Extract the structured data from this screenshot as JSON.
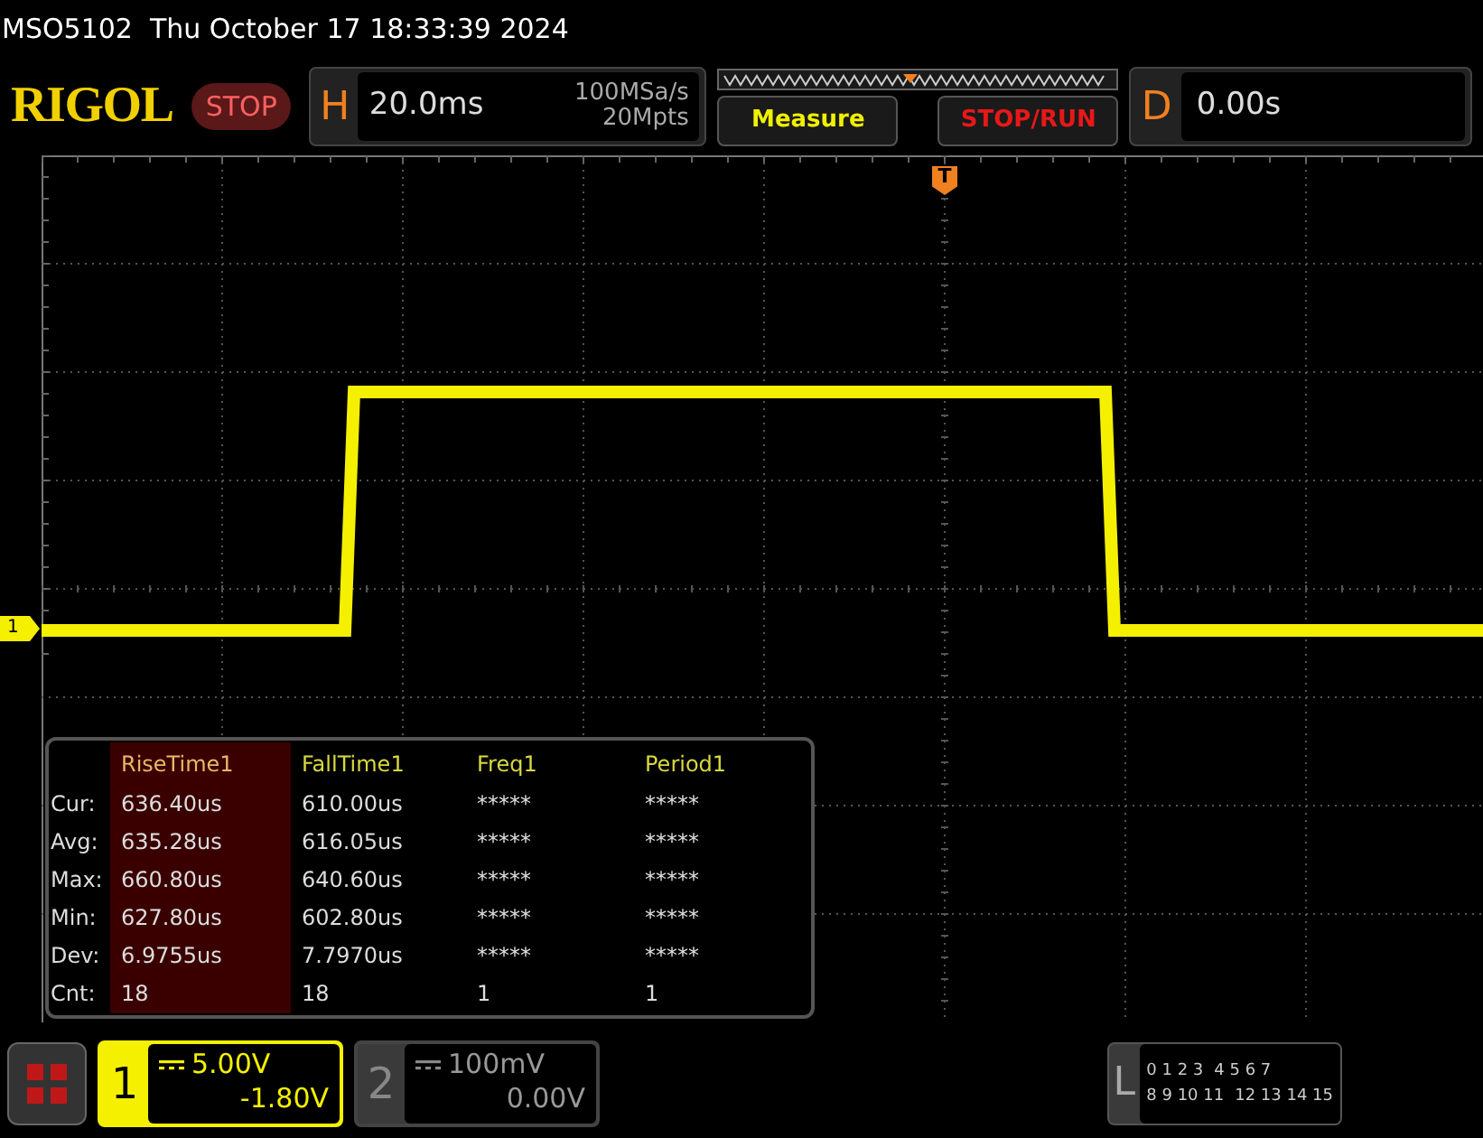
{
  "status_bar": {
    "text": "MSO5102  Thu October 17 18:33:39 2024"
  },
  "toolbar": {
    "logo": "RIGOL",
    "run_state": "STOP",
    "horizontal": {
      "label": "H",
      "timebase": "20.0ms",
      "sample_rate": "100MSa/s",
      "memory_depth": "20Mpts"
    },
    "buttons": [
      {
        "label": "Measure",
        "color": "#f0f000"
      },
      {
        "label": "STOP/RUN",
        "color": "#e81818"
      }
    ],
    "delay": {
      "label": "D",
      "value": "0.00s"
    }
  },
  "trigger_marker": "T",
  "channel_marker": "1",
  "measurements": {
    "columns": [
      {
        "label": "RiseTime1",
        "selected": true
      },
      {
        "label": "FallTime1",
        "selected": false
      },
      {
        "label": "Freq1",
        "selected": false
      },
      {
        "label": "Period1",
        "selected": false
      }
    ],
    "rows": [
      {
        "label": "Cur:",
        "values": [
          "636.40us",
          "610.00us",
          "*****",
          "*****"
        ]
      },
      {
        "label": "Avg:",
        "values": [
          "635.28us",
          "616.05us",
          "*****",
          "*****"
        ]
      },
      {
        "label": "Max:",
        "values": [
          "660.80us",
          "640.60us",
          "*****",
          "*****"
        ]
      },
      {
        "label": "Min:",
        "values": [
          "627.80us",
          "602.80us",
          "*****",
          "*****"
        ]
      },
      {
        "label": "Dev:",
        "values": [
          "6.9755us",
          "7.7970us",
          "*****",
          "*****"
        ]
      },
      {
        "label": "Cnt:",
        "values": [
          "18",
          "18",
          "1",
          "1"
        ]
      }
    ]
  },
  "channels": [
    {
      "number": "1",
      "scale": "5.00V",
      "offset": "-1.80V",
      "selected": true
    },
    {
      "number": "2",
      "scale": "100mV",
      "offset": "0.00V",
      "selected": false
    }
  ],
  "logic": {
    "label": "L",
    "rows": [
      [
        "0 1 2 3",
        "4 5 6 7"
      ],
      [
        "8 9 10 11",
        "12 13 14 15"
      ]
    ]
  }
}
